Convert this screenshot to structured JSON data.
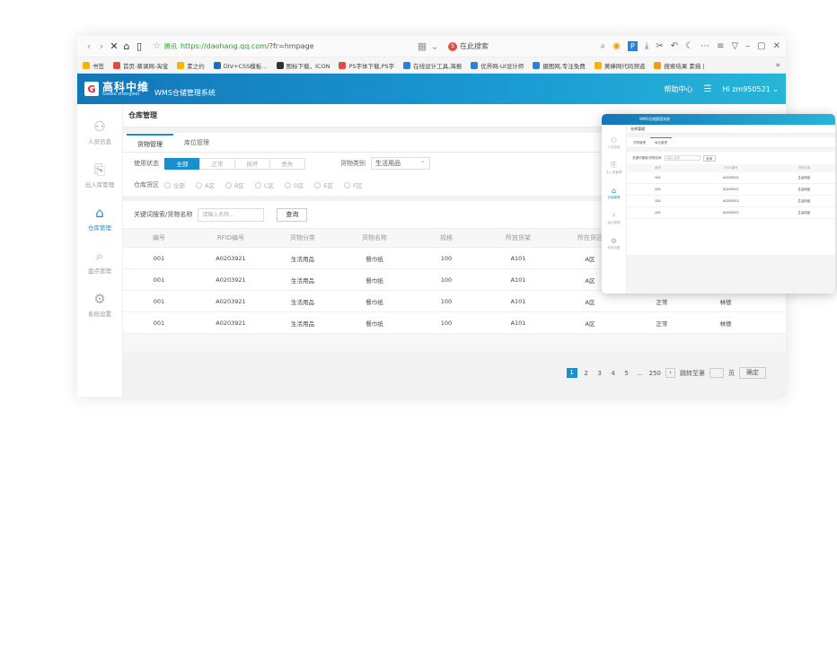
{
  "browser": {
    "url_secure_label": "腾讯",
    "url_host": "https://daohang.qq.com",
    "url_path": "/?fr=hmpage",
    "search_engine_label": "在此搜索",
    "bookmarks": [
      {
        "label": "书签",
        "color": "#f5b400"
      },
      {
        "label": "首页-慕课网-淘宝",
        "color": "#e24c3e"
      },
      {
        "label": "素之约",
        "color": "#f5b400"
      },
      {
        "label": "DIV+CSS模板...",
        "color": "#1a6fc0"
      },
      {
        "label": "图标下载，ICON",
        "color": "#333333"
      },
      {
        "label": "PS字体下载,PS字",
        "color": "#e24c3e"
      },
      {
        "label": "在线设计工具,海报",
        "color": "#2e7fd6"
      },
      {
        "label": "优界网-UI设计师",
        "color": "#2e7fd6"
      },
      {
        "label": "摄图网,专注免费",
        "color": "#2e7fd6"
      },
      {
        "label": "黄蜂网代码频道",
        "color": "#f5b400"
      },
      {
        "label": "搜索结果 素描 |",
        "color": "#f39c12"
      }
    ]
  },
  "app": {
    "logo_mark": "G",
    "logo_cn": "高科中维",
    "logo_en": "Gaoke zhongwei",
    "system_name": "WMS仓储管理系统",
    "help_label": "帮助中心",
    "user_label": "Hi zm950521"
  },
  "sidebar": {
    "items": [
      {
        "label": "人员信息",
        "icon": "user-icon"
      },
      {
        "label": "出入库管理",
        "icon": "inout-icon"
      },
      {
        "label": "仓库管理",
        "icon": "warehouse-icon"
      },
      {
        "label": "盘点管理",
        "icon": "inventory-icon"
      },
      {
        "label": "系统设置",
        "icon": "gear-icon"
      }
    ]
  },
  "main": {
    "title": "仓库管理",
    "tabs": [
      {
        "label": "货物管理"
      },
      {
        "label": "库位管理"
      }
    ],
    "status_label": "使用状态",
    "status_options": [
      "全部",
      "正常",
      "损坏",
      "丢失"
    ],
    "category_label": "货物类别",
    "category_value": "生活用品",
    "zone_label": "仓库货区",
    "zones": [
      "全部",
      "A区",
      "B区",
      "C区",
      "D区",
      "E区",
      "F区"
    ],
    "search_label": "关键词搜索/货物名称",
    "search_placeholder": "请输入名称...",
    "search_button": "查询",
    "columns": [
      "编号",
      "RFID编号",
      "货物分类",
      "货物名称",
      "规格",
      "所放货架",
      "所在货区",
      "",
      ""
    ],
    "rows": [
      [
        "001",
        "A0203921",
        "生活用品",
        "餐巾纸",
        "100",
        "A101",
        "A区",
        "",
        ""
      ],
      [
        "001",
        "A0203921",
        "生活用品",
        "餐巾纸",
        "100",
        "A101",
        "A区",
        "",
        ""
      ],
      [
        "001",
        "A0203921",
        "生活用品",
        "餐巾纸",
        "100",
        "A101",
        "A区",
        "正常",
        "林德"
      ],
      [
        "001",
        "A0203921",
        "生活用品",
        "餐巾纸",
        "100",
        "A101",
        "A区",
        "正常",
        "林德"
      ]
    ],
    "pager": {
      "pages": [
        "1",
        "2",
        "3",
        "4",
        "5"
      ],
      "ellipsis": "...",
      "last": "250",
      "next": "›",
      "jump_label": "跳转至第",
      "jump_suffix": "页",
      "confirm": "确定"
    }
  },
  "mini": {
    "system_name": "WMS仓储管理系统",
    "title": "仓库管理",
    "tabs": [
      "货物管理",
      "库位管理"
    ],
    "search_label": "关键词搜索/货物名称",
    "search_placeholder": "请输入名称...",
    "search_button": "查询",
    "sidebar": [
      "人员信息",
      "出入库管理",
      "仓库管理",
      "盘点管理",
      "系统设置"
    ],
    "columns": [
      "编号",
      "RFID编号",
      "货物分类"
    ],
    "rows": [
      [
        "001",
        "A0203921",
        "生活用品"
      ],
      [
        "001",
        "A0203921",
        "生活用品"
      ],
      [
        "001",
        "A0203921",
        "生活用品"
      ],
      [
        "001",
        "A0203921",
        "生活用品"
      ]
    ]
  }
}
